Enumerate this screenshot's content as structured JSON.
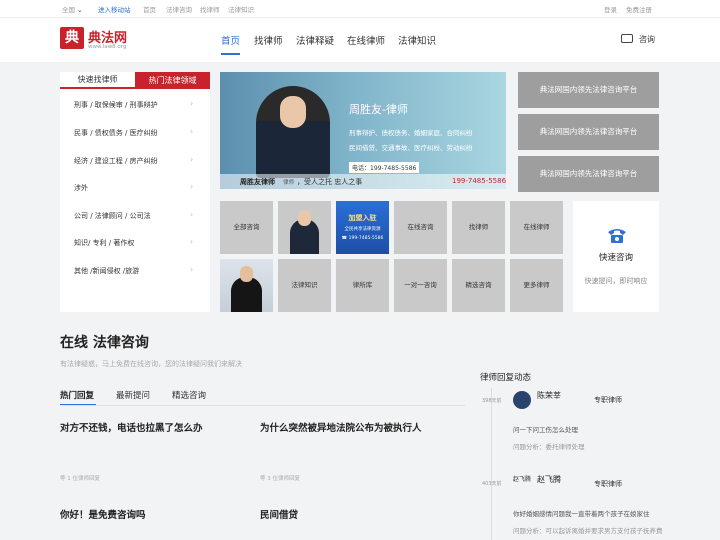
{
  "topbar": {
    "region": "全国",
    "mobile_link": "进入移动站",
    "links": [
      "首页",
      "法律咨询",
      "找律师",
      "法律知识"
    ],
    "login": "登录",
    "register": "免费注册"
  },
  "header": {
    "logo_char": "典",
    "logo_name": "典法网",
    "logo_domain": "www.law8.org",
    "nav": [
      "首页",
      "找律师",
      "法律释疑",
      "在线律师",
      "法律知识"
    ],
    "consult": "咨询"
  },
  "left_panel": {
    "tab_quick": "快速找律师",
    "tab_hot": "热门法律领域",
    "rows": [
      "刑事 / 取保候审 / 刑事辩护",
      "民事 / 债权债务 / 医疗纠纷",
      "经济 / 建设工程 / 房产纠纷",
      "涉外",
      "公司 / 法律顾问 / 公司法",
      "知识/ 专利 / 著作权",
      "其他 /新闻侵权 /旅游"
    ]
  },
  "banner": {
    "name": "周胜友-律师",
    "lines": [
      "刑事辩护、债权债务、婚姻家庭、合同纠纷",
      "民间借贷、交通事故、医疗纠纷、劳动纠纷"
    ],
    "phone": "电话：199-7485-5586",
    "footer_name": "周胜友律师",
    "footer_title": "律师",
    "footer_slogan": "，受人之托 忠人之事",
    "footer_phone": "199-7485-5586"
  },
  "side_promos": [
    "典法网国内领先法律咨询平台",
    "典法网国内领先法律咨询平台",
    "典法网国内领先法律咨询平台"
  ],
  "tiles": {
    "row1": [
      "全部咨询",
      "",
      "",
      "在线咨询",
      "找律师",
      "在线律师"
    ],
    "join": "加盟入驻",
    "join_sub": "全民共享法律资源",
    "join_phone": "☎ 199-7485-5586",
    "row2": [
      "",
      "法律知识",
      "律所库",
      "一对一咨询",
      "精选咨询",
      "更多律师"
    ]
  },
  "call_card": {
    "title": "快速咨询",
    "sub": "快速提问，即时响应"
  },
  "section": {
    "title": "在线  法律咨询",
    "subtitle": "有法律疑惑，马上免费在线咨询，您的法律疑问我们来解决",
    "tabs": [
      "热门回复",
      "最新提问",
      "精选咨询"
    ]
  },
  "questions": [
    {
      "q": "对方不还钱，电话也拉黑了怎么办",
      "meta": "等 1 位律师回复"
    },
    {
      "q": "为什么突然被异地法院公布为被执行人",
      "meta": "等 3 位律师回复"
    },
    {
      "q": "你好！是免费咨询吗",
      "meta": ""
    },
    {
      "q": "民间借贷",
      "meta": ""
    }
  ],
  "feed": {
    "title": "律师回复动态",
    "items": [
      {
        "time": "398天前",
        "name": "陈荣莘",
        "role": "专职律师",
        "q": "问一下问工伤怎么处理",
        "a": "问题分析：委托律师处理",
        "avatar_alt": ""
      },
      {
        "time": "403天前",
        "name": "赵飞腾",
        "role": "专职律师",
        "q": "你好婚姻感情问题我一直带着两个孩子在娘家住",
        "a": "问题分析：可以起诉离婚并要求男方支付孩子抚养费",
        "avatar_alt": "赵飞腾"
      }
    ]
  }
}
